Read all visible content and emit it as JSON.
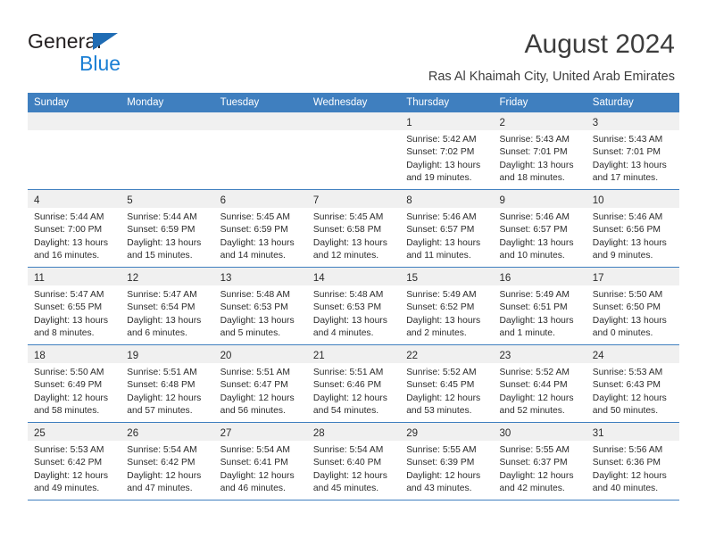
{
  "brand": {
    "word1": "General",
    "word2": "Blue",
    "triangle_color": "#1f6cb4",
    "blue_color": "#1b7fd4"
  },
  "header": {
    "title": "August 2024",
    "subtitle": "Ras Al Khaimah City, United Arab Emirates"
  },
  "calendar": {
    "header_bg": "#3f7fbf",
    "daynum_bg": "#f0f0f0",
    "weekday_headers": [
      "Sunday",
      "Monday",
      "Tuesday",
      "Wednesday",
      "Thursday",
      "Friday",
      "Saturday"
    ],
    "weeks": [
      [
        {
          "day": "",
          "lines": []
        },
        {
          "day": "",
          "lines": []
        },
        {
          "day": "",
          "lines": []
        },
        {
          "day": "",
          "lines": []
        },
        {
          "day": "1",
          "lines": [
            "Sunrise: 5:42 AM",
            "Sunset: 7:02 PM",
            "Daylight: 13 hours",
            "and 19 minutes."
          ]
        },
        {
          "day": "2",
          "lines": [
            "Sunrise: 5:43 AM",
            "Sunset: 7:01 PM",
            "Daylight: 13 hours",
            "and 18 minutes."
          ]
        },
        {
          "day": "3",
          "lines": [
            "Sunrise: 5:43 AM",
            "Sunset: 7:01 PM",
            "Daylight: 13 hours",
            "and 17 minutes."
          ]
        }
      ],
      [
        {
          "day": "4",
          "lines": [
            "Sunrise: 5:44 AM",
            "Sunset: 7:00 PM",
            "Daylight: 13 hours",
            "and 16 minutes."
          ]
        },
        {
          "day": "5",
          "lines": [
            "Sunrise: 5:44 AM",
            "Sunset: 6:59 PM",
            "Daylight: 13 hours",
            "and 15 minutes."
          ]
        },
        {
          "day": "6",
          "lines": [
            "Sunrise: 5:45 AM",
            "Sunset: 6:59 PM",
            "Daylight: 13 hours",
            "and 14 minutes."
          ]
        },
        {
          "day": "7",
          "lines": [
            "Sunrise: 5:45 AM",
            "Sunset: 6:58 PM",
            "Daylight: 13 hours",
            "and 12 minutes."
          ]
        },
        {
          "day": "8",
          "lines": [
            "Sunrise: 5:46 AM",
            "Sunset: 6:57 PM",
            "Daylight: 13 hours",
            "and 11 minutes."
          ]
        },
        {
          "day": "9",
          "lines": [
            "Sunrise: 5:46 AM",
            "Sunset: 6:57 PM",
            "Daylight: 13 hours",
            "and 10 minutes."
          ]
        },
        {
          "day": "10",
          "lines": [
            "Sunrise: 5:46 AM",
            "Sunset: 6:56 PM",
            "Daylight: 13 hours",
            "and 9 minutes."
          ]
        }
      ],
      [
        {
          "day": "11",
          "lines": [
            "Sunrise: 5:47 AM",
            "Sunset: 6:55 PM",
            "Daylight: 13 hours",
            "and 8 minutes."
          ]
        },
        {
          "day": "12",
          "lines": [
            "Sunrise: 5:47 AM",
            "Sunset: 6:54 PM",
            "Daylight: 13 hours",
            "and 6 minutes."
          ]
        },
        {
          "day": "13",
          "lines": [
            "Sunrise: 5:48 AM",
            "Sunset: 6:53 PM",
            "Daylight: 13 hours",
            "and 5 minutes."
          ]
        },
        {
          "day": "14",
          "lines": [
            "Sunrise: 5:48 AM",
            "Sunset: 6:53 PM",
            "Daylight: 13 hours",
            "and 4 minutes."
          ]
        },
        {
          "day": "15",
          "lines": [
            "Sunrise: 5:49 AM",
            "Sunset: 6:52 PM",
            "Daylight: 13 hours",
            "and 2 minutes."
          ]
        },
        {
          "day": "16",
          "lines": [
            "Sunrise: 5:49 AM",
            "Sunset: 6:51 PM",
            "Daylight: 13 hours",
            "and 1 minute."
          ]
        },
        {
          "day": "17",
          "lines": [
            "Sunrise: 5:50 AM",
            "Sunset: 6:50 PM",
            "Daylight: 13 hours",
            "and 0 minutes."
          ]
        }
      ],
      [
        {
          "day": "18",
          "lines": [
            "Sunrise: 5:50 AM",
            "Sunset: 6:49 PM",
            "Daylight: 12 hours",
            "and 58 minutes."
          ]
        },
        {
          "day": "19",
          "lines": [
            "Sunrise: 5:51 AM",
            "Sunset: 6:48 PM",
            "Daylight: 12 hours",
            "and 57 minutes."
          ]
        },
        {
          "day": "20",
          "lines": [
            "Sunrise: 5:51 AM",
            "Sunset: 6:47 PM",
            "Daylight: 12 hours",
            "and 56 minutes."
          ]
        },
        {
          "day": "21",
          "lines": [
            "Sunrise: 5:51 AM",
            "Sunset: 6:46 PM",
            "Daylight: 12 hours",
            "and 54 minutes."
          ]
        },
        {
          "day": "22",
          "lines": [
            "Sunrise: 5:52 AM",
            "Sunset: 6:45 PM",
            "Daylight: 12 hours",
            "and 53 minutes."
          ]
        },
        {
          "day": "23",
          "lines": [
            "Sunrise: 5:52 AM",
            "Sunset: 6:44 PM",
            "Daylight: 12 hours",
            "and 52 minutes."
          ]
        },
        {
          "day": "24",
          "lines": [
            "Sunrise: 5:53 AM",
            "Sunset: 6:43 PM",
            "Daylight: 12 hours",
            "and 50 minutes."
          ]
        }
      ],
      [
        {
          "day": "25",
          "lines": [
            "Sunrise: 5:53 AM",
            "Sunset: 6:42 PM",
            "Daylight: 12 hours",
            "and 49 minutes."
          ]
        },
        {
          "day": "26",
          "lines": [
            "Sunrise: 5:54 AM",
            "Sunset: 6:42 PM",
            "Daylight: 12 hours",
            "and 47 minutes."
          ]
        },
        {
          "day": "27",
          "lines": [
            "Sunrise: 5:54 AM",
            "Sunset: 6:41 PM",
            "Daylight: 12 hours",
            "and 46 minutes."
          ]
        },
        {
          "day": "28",
          "lines": [
            "Sunrise: 5:54 AM",
            "Sunset: 6:40 PM",
            "Daylight: 12 hours",
            "and 45 minutes."
          ]
        },
        {
          "day": "29",
          "lines": [
            "Sunrise: 5:55 AM",
            "Sunset: 6:39 PM",
            "Daylight: 12 hours",
            "and 43 minutes."
          ]
        },
        {
          "day": "30",
          "lines": [
            "Sunrise: 5:55 AM",
            "Sunset: 6:37 PM",
            "Daylight: 12 hours",
            "and 42 minutes."
          ]
        },
        {
          "day": "31",
          "lines": [
            "Sunrise: 5:56 AM",
            "Sunset: 6:36 PM",
            "Daylight: 12 hours",
            "and 40 minutes."
          ]
        }
      ]
    ]
  }
}
